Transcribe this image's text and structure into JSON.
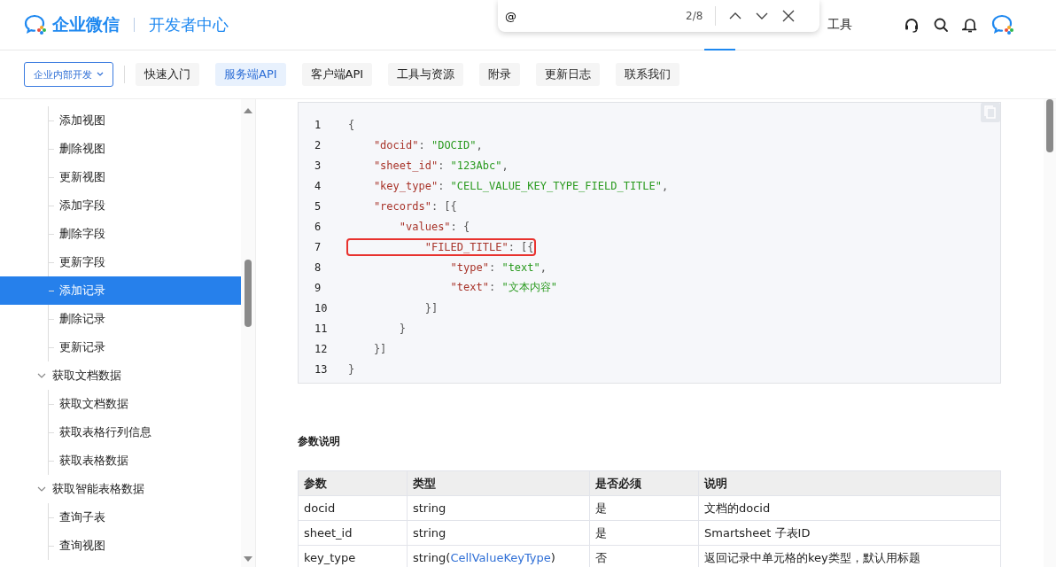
{
  "header": {
    "brand": "企业微信",
    "section": "开发者中心",
    "nav_item": "工具"
  },
  "find_bar": {
    "value": "@",
    "count": "2/8"
  },
  "subnav": {
    "dropdown": "企业内部开发",
    "tabs": [
      {
        "label": "快速入门",
        "selected": false
      },
      {
        "label": "服务端API",
        "selected": true
      },
      {
        "label": "客户端API",
        "selected": false
      },
      {
        "label": "工具与资源",
        "selected": false
      },
      {
        "label": "附录",
        "selected": false
      },
      {
        "label": "更新日志",
        "selected": false
      },
      {
        "label": "联系我们",
        "selected": false
      }
    ]
  },
  "sidebar": {
    "sections": [
      {
        "children": [
          {
            "label": "添加视图",
            "selected": false
          },
          {
            "label": "删除视图",
            "selected": false
          },
          {
            "label": "更新视图",
            "selected": false
          },
          {
            "label": "添加字段",
            "selected": false
          },
          {
            "label": "删除字段",
            "selected": false
          },
          {
            "label": "更新字段",
            "selected": false
          },
          {
            "label": "添加记录",
            "selected": true
          },
          {
            "label": "删除记录",
            "selected": false
          },
          {
            "label": "更新记录",
            "selected": false
          }
        ]
      },
      {
        "label": "获取文档数据",
        "expanded": true,
        "children": [
          {
            "label": "获取文档数据",
            "selected": false
          },
          {
            "label": "获取表格行列信息",
            "selected": false
          },
          {
            "label": "获取表格数据",
            "selected": false
          }
        ]
      },
      {
        "label": "获取智能表格数据",
        "expanded": true,
        "children": [
          {
            "label": "查询子表",
            "selected": false
          },
          {
            "label": "查询视图",
            "selected": false
          }
        ]
      }
    ]
  },
  "code": {
    "lines": [
      {
        "number": "1",
        "highlighted": false,
        "tokens": [
          {
            "kind": "punct",
            "text": "{"
          }
        ]
      },
      {
        "number": "2",
        "highlighted": false,
        "tokens": [
          {
            "kind": "key",
            "text": "    \"docid\""
          },
          {
            "kind": "punct",
            "text": ": "
          },
          {
            "kind": "string",
            "text": "\"DOCID\""
          },
          {
            "kind": "punct",
            "text": ","
          }
        ]
      },
      {
        "number": "3",
        "highlighted": false,
        "tokens": [
          {
            "kind": "key",
            "text": "    \"sheet_id\""
          },
          {
            "kind": "punct",
            "text": ": "
          },
          {
            "kind": "string",
            "text": "\"123Abc\""
          },
          {
            "kind": "punct",
            "text": ","
          }
        ]
      },
      {
        "number": "4",
        "highlighted": false,
        "tokens": [
          {
            "kind": "key",
            "text": "    \"key_type\""
          },
          {
            "kind": "punct",
            "text": ": "
          },
          {
            "kind": "string",
            "text": "\"CELL_VALUE_KEY_TYPE_FIELD_TITLE\""
          },
          {
            "kind": "punct",
            "text": ","
          }
        ]
      },
      {
        "number": "5",
        "highlighted": false,
        "tokens": [
          {
            "kind": "key",
            "text": "    \"records\""
          },
          {
            "kind": "punct",
            "text": ": [{"
          }
        ]
      },
      {
        "number": "6",
        "highlighted": false,
        "tokens": [
          {
            "kind": "key",
            "text": "        \"values\""
          },
          {
            "kind": "punct",
            "text": ": {"
          }
        ]
      },
      {
        "number": "7",
        "highlighted": true,
        "tokens": [
          {
            "kind": "key",
            "text": "            \"FILED_TITLE\""
          },
          {
            "kind": "punct",
            "text": ": [{"
          }
        ]
      },
      {
        "number": "8",
        "highlighted": false,
        "tokens": [
          {
            "kind": "key",
            "text": "                \"type\""
          },
          {
            "kind": "punct",
            "text": ": "
          },
          {
            "kind": "string",
            "text": "\"text\""
          },
          {
            "kind": "punct",
            "text": ","
          }
        ]
      },
      {
        "number": "9",
        "highlighted": false,
        "tokens": [
          {
            "kind": "key",
            "text": "                \"text\""
          },
          {
            "kind": "punct",
            "text": ": "
          },
          {
            "kind": "string",
            "text": "\"文本内容\""
          }
        ]
      },
      {
        "number": "10",
        "highlighted": false,
        "tokens": [
          {
            "kind": "punct",
            "text": "            }]"
          }
        ]
      },
      {
        "number": "11",
        "highlighted": false,
        "tokens": [
          {
            "kind": "punct",
            "text": "        }"
          }
        ]
      },
      {
        "number": "12",
        "highlighted": false,
        "tokens": [
          {
            "kind": "punct",
            "text": "    }]"
          }
        ]
      },
      {
        "number": "13",
        "highlighted": false,
        "tokens": [
          {
            "kind": "punct",
            "text": "}"
          }
        ]
      }
    ]
  },
  "params": {
    "heading": "参数说明",
    "columns": [
      "参数",
      "类型",
      "是否必须",
      "说明"
    ],
    "rows": [
      {
        "name": "docid",
        "type": "string",
        "required": "是",
        "description": "文档的docid"
      },
      {
        "name": "sheet_id",
        "type": "string",
        "required": "是",
        "description": "Smartsheet 子表ID"
      },
      {
        "name": "key_type",
        "type": "string(",
        "type_link": "CellValueKeyType",
        "type_suffix": ")",
        "required": "否",
        "description": "返回记录中单元格的key类型，默认用标题"
      }
    ]
  }
}
